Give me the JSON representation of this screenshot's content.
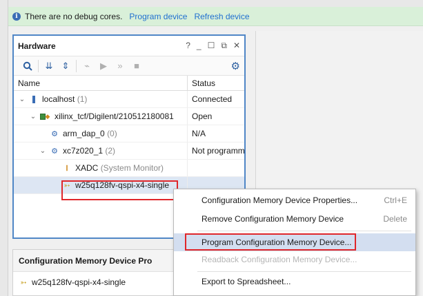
{
  "banner": {
    "message": "There are no debug cores.",
    "link_program": "Program device",
    "link_refresh": "Refresh device"
  },
  "hardware": {
    "title": "Hardware",
    "ctrl_help": "?",
    "columns": {
      "name": "Name",
      "status": "Status"
    },
    "rows": [
      {
        "name": "localhost",
        "extra": "(1)",
        "status": "Connected"
      },
      {
        "name": "xilinx_tcf/Digilent/210512180081",
        "extra": "",
        "status": "Open"
      },
      {
        "name": "arm_dap_0",
        "extra": "(0)",
        "status": "N/A"
      },
      {
        "name": "xc7z020_1",
        "extra": "(2)",
        "status": "Not programm"
      },
      {
        "name": "XADC",
        "extra": "(System Monitor)",
        "status": ""
      },
      {
        "name": "w25q128fv-qspi-x4-single",
        "extra": "",
        "status": ""
      }
    ]
  },
  "cfg_panel": {
    "title": "Configuration Memory Device Pro",
    "item": "w25q128fv-qspi-x4-single"
  },
  "context_menu": {
    "items": [
      {
        "label": "Configuration Memory Device Properties...",
        "shortcut": "Ctrl+E"
      },
      {
        "label": "Remove Configuration Memory Device",
        "shortcut": "Delete"
      },
      {
        "label": "Program Configuration Memory Device...",
        "shortcut": ""
      },
      {
        "label": "Readback Configuration Memory Device...",
        "shortcut": ""
      },
      {
        "label": "Export to Spreadsheet...",
        "shortcut": ""
      }
    ]
  },
  "colors": {
    "accent": "#4f86c6",
    "banner_bg": "#d9f0d9",
    "link": "#1f6fd0",
    "highlight_red": "#e0262a",
    "selection": "#dde6f3"
  }
}
